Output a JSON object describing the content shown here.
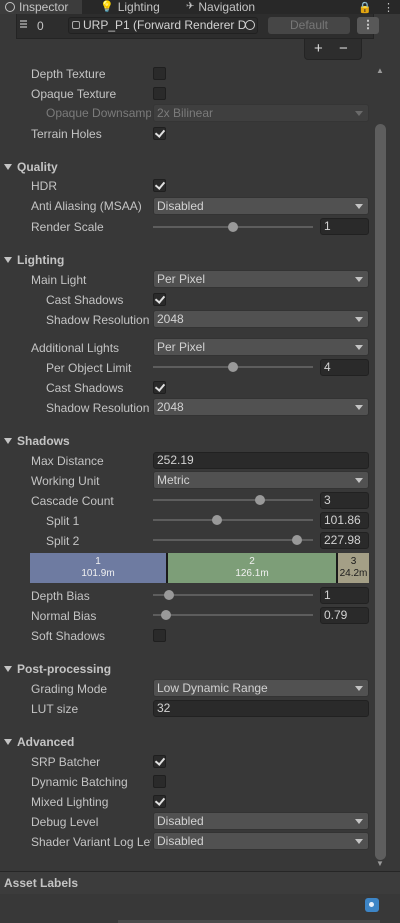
{
  "tabs": [
    {
      "label": "Inspector",
      "icon": "info-icon"
    },
    {
      "label": "Lighting",
      "icon": "lightbulb-icon"
    },
    {
      "label": "Navigation",
      "icon": "navigation-icon"
    }
  ],
  "pipeline": {
    "index": "0",
    "asset": "URP_P1 (Forward Renderer D",
    "default_label": "Default",
    "menu_label": "⋮",
    "add": "+",
    "remove": "−"
  },
  "rendering": {
    "depth_texture": {
      "label": "Depth Texture",
      "checked": false
    },
    "opaque_texture": {
      "label": "Opaque Texture",
      "checked": false
    },
    "opaque_downsampling": {
      "label": "Opaque Downsampling",
      "value": "2x Bilinear"
    },
    "terrain_holes": {
      "label": "Terrain Holes",
      "checked": true
    }
  },
  "quality": {
    "title": "Quality",
    "hdr": {
      "label": "HDR",
      "checked": true
    },
    "msaa": {
      "label": "Anti Aliasing (MSAA)",
      "value": "Disabled"
    },
    "render_scale": {
      "label": "Render Scale",
      "value": "1",
      "fraction": 0.5
    }
  },
  "lighting": {
    "title": "Lighting",
    "main_light": {
      "label": "Main Light",
      "value": "Per Pixel"
    },
    "main_cast_shadows": {
      "label": "Cast Shadows",
      "checked": true
    },
    "main_shadow_res": {
      "label": "Shadow Resolution",
      "value": "2048"
    },
    "additional_lights": {
      "label": "Additional Lights",
      "value": "Per Pixel"
    },
    "per_object_limit": {
      "label": "Per Object Limit",
      "value": "4",
      "fraction": 0.5
    },
    "add_cast_shadows": {
      "label": "Cast Shadows",
      "checked": true
    },
    "add_shadow_res": {
      "label": "Shadow Resolution",
      "value": "2048"
    }
  },
  "shadows": {
    "title": "Shadows",
    "max_distance": {
      "label": "Max Distance",
      "value": "252.19"
    },
    "working_unit": {
      "label": "Working Unit",
      "value": "Metric"
    },
    "cascade_count": {
      "label": "Cascade Count",
      "value": "3",
      "fraction": 0.67
    },
    "split1": {
      "label": "Split 1",
      "value": "101.86",
      "fraction": 0.4
    },
    "split2": {
      "label": "Split 2",
      "value": "227.98",
      "fraction": 0.9
    },
    "cascades": [
      {
        "index": "1",
        "distance": "101.9m"
      },
      {
        "index": "2",
        "distance": "126.1m"
      },
      {
        "index": "3",
        "distance": "24.2m"
      }
    ],
    "depth_bias": {
      "label": "Depth Bias",
      "value": "1",
      "fraction": 0.1
    },
    "normal_bias": {
      "label": "Normal Bias",
      "value": "0.79",
      "fraction": 0.08
    },
    "soft_shadows": {
      "label": "Soft Shadows",
      "checked": false
    }
  },
  "post": {
    "title": "Post-processing",
    "grading_mode": {
      "label": "Grading Mode",
      "value": "Low Dynamic Range"
    },
    "lut_size": {
      "label": "LUT size",
      "value": "32"
    }
  },
  "advanced": {
    "title": "Advanced",
    "srp_batcher": {
      "label": "SRP Batcher",
      "checked": true
    },
    "dynamic_batching": {
      "label": "Dynamic Batching",
      "checked": false
    },
    "mixed_lighting": {
      "label": "Mixed Lighting",
      "checked": true
    },
    "debug_level": {
      "label": "Debug Level",
      "value": "Disabled"
    },
    "shader_variant_log": {
      "label": "Shader Variant Log Level",
      "value": "Disabled"
    }
  },
  "asset_labels": {
    "title": "Asset Labels"
  }
}
